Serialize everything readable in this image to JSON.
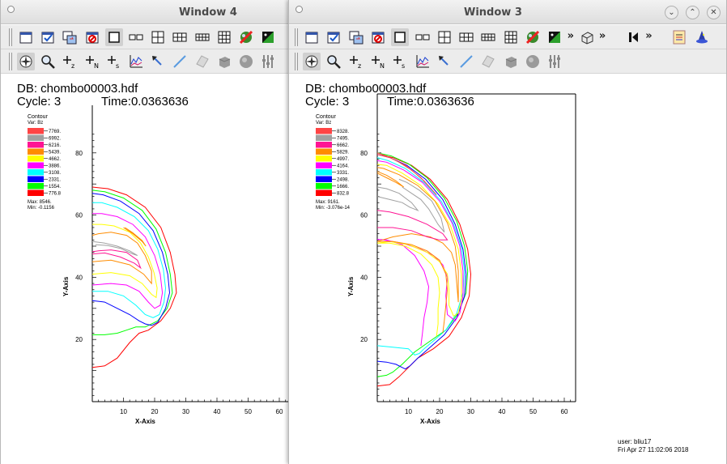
{
  "windows": {
    "win4": {
      "title": "Window 4",
      "plot": {
        "db_label": "DB: chombo00003.hdf",
        "cycle_label": "Cycle: 3",
        "time_label": "Time:0.0363636",
        "legend_title": "Contour",
        "legend_var": "Var: Bz",
        "legend_levels": [
          "7769.",
          "6992.",
          "6216.",
          "5439.",
          "4662.",
          "3886.",
          "3108.",
          "2331.",
          "1554.",
          "776.8"
        ],
        "legend_max": "Max: 8546.",
        "legend_min": "Min: -0.1156",
        "x_axis_label": "X-Axis",
        "y_axis_label": "Y-Axis",
        "x_ticks": [
          "10",
          "20",
          "30",
          "40",
          "50",
          "60"
        ],
        "y_ticks": [
          "20",
          "40",
          "60",
          "80"
        ]
      }
    },
    "win3": {
      "title": "Window 3",
      "plot": {
        "db_label": "DB: chombo00003.hdf",
        "cycle_label": "Cycle: 3",
        "time_label": "Time:0.0363636",
        "legend_title": "Contour",
        "legend_var": "Var: Bz",
        "legend_levels": [
          "8328.",
          "7495.",
          "6662.",
          "5829.",
          "4997.",
          "4164.",
          "3331.",
          "2498.",
          "1666.",
          "832.8"
        ],
        "legend_max": "Max: 9161.",
        "legend_min": "Min: -3.076e-14",
        "x_axis_label": "X-Axis",
        "y_axis_label": "Y-Axis",
        "x_ticks": [
          "10",
          "20",
          "30",
          "40",
          "50",
          "60"
        ],
        "y_ticks": [
          "20",
          "40",
          "60",
          "80"
        ]
      },
      "user_label": "user: bliu17",
      "date_label": "Fri Apr 27 11:02:06 2018"
    }
  },
  "contour_colors": [
    "#ff4444",
    "#a0a0a0",
    "#ff1493",
    "#ff8c00",
    "#ffff00",
    "#ff00ff",
    "#00ffff",
    "#0000ff",
    "#00ff00",
    "#ff0000"
  ],
  "title_buttons": {
    "minimize": "⌄",
    "maximize": "⌃",
    "close": "✕"
  },
  "toolbar_more": "»",
  "toolbar_icons_row1": [
    "new-window-icon",
    "active-window-icon",
    "copy-window-icon",
    "clear-window-icon",
    "layout-1x1-icon",
    "layout-1x2-icon",
    "layout-2x2-icon",
    "layout-2x3-icon",
    "layout-2x4-icon",
    "layout-3x3-icon",
    "spin-lock-icon",
    "invert-icon",
    "perspective-icon",
    "animation-reverse-icon",
    "plot-list-icon",
    "wizard-icon"
  ],
  "toolbar_icons_row2": [
    "navigate-icon",
    "zoom-icon",
    "zone-pick-icon",
    "node-pick-icon",
    "spreadsheet-pick-icon",
    "curve-icon",
    "point-tool-icon",
    "line-tool-icon",
    "plane-tool-icon",
    "box-tool-icon",
    "sphere-tool-icon",
    "axis-restrict-icon"
  ]
}
